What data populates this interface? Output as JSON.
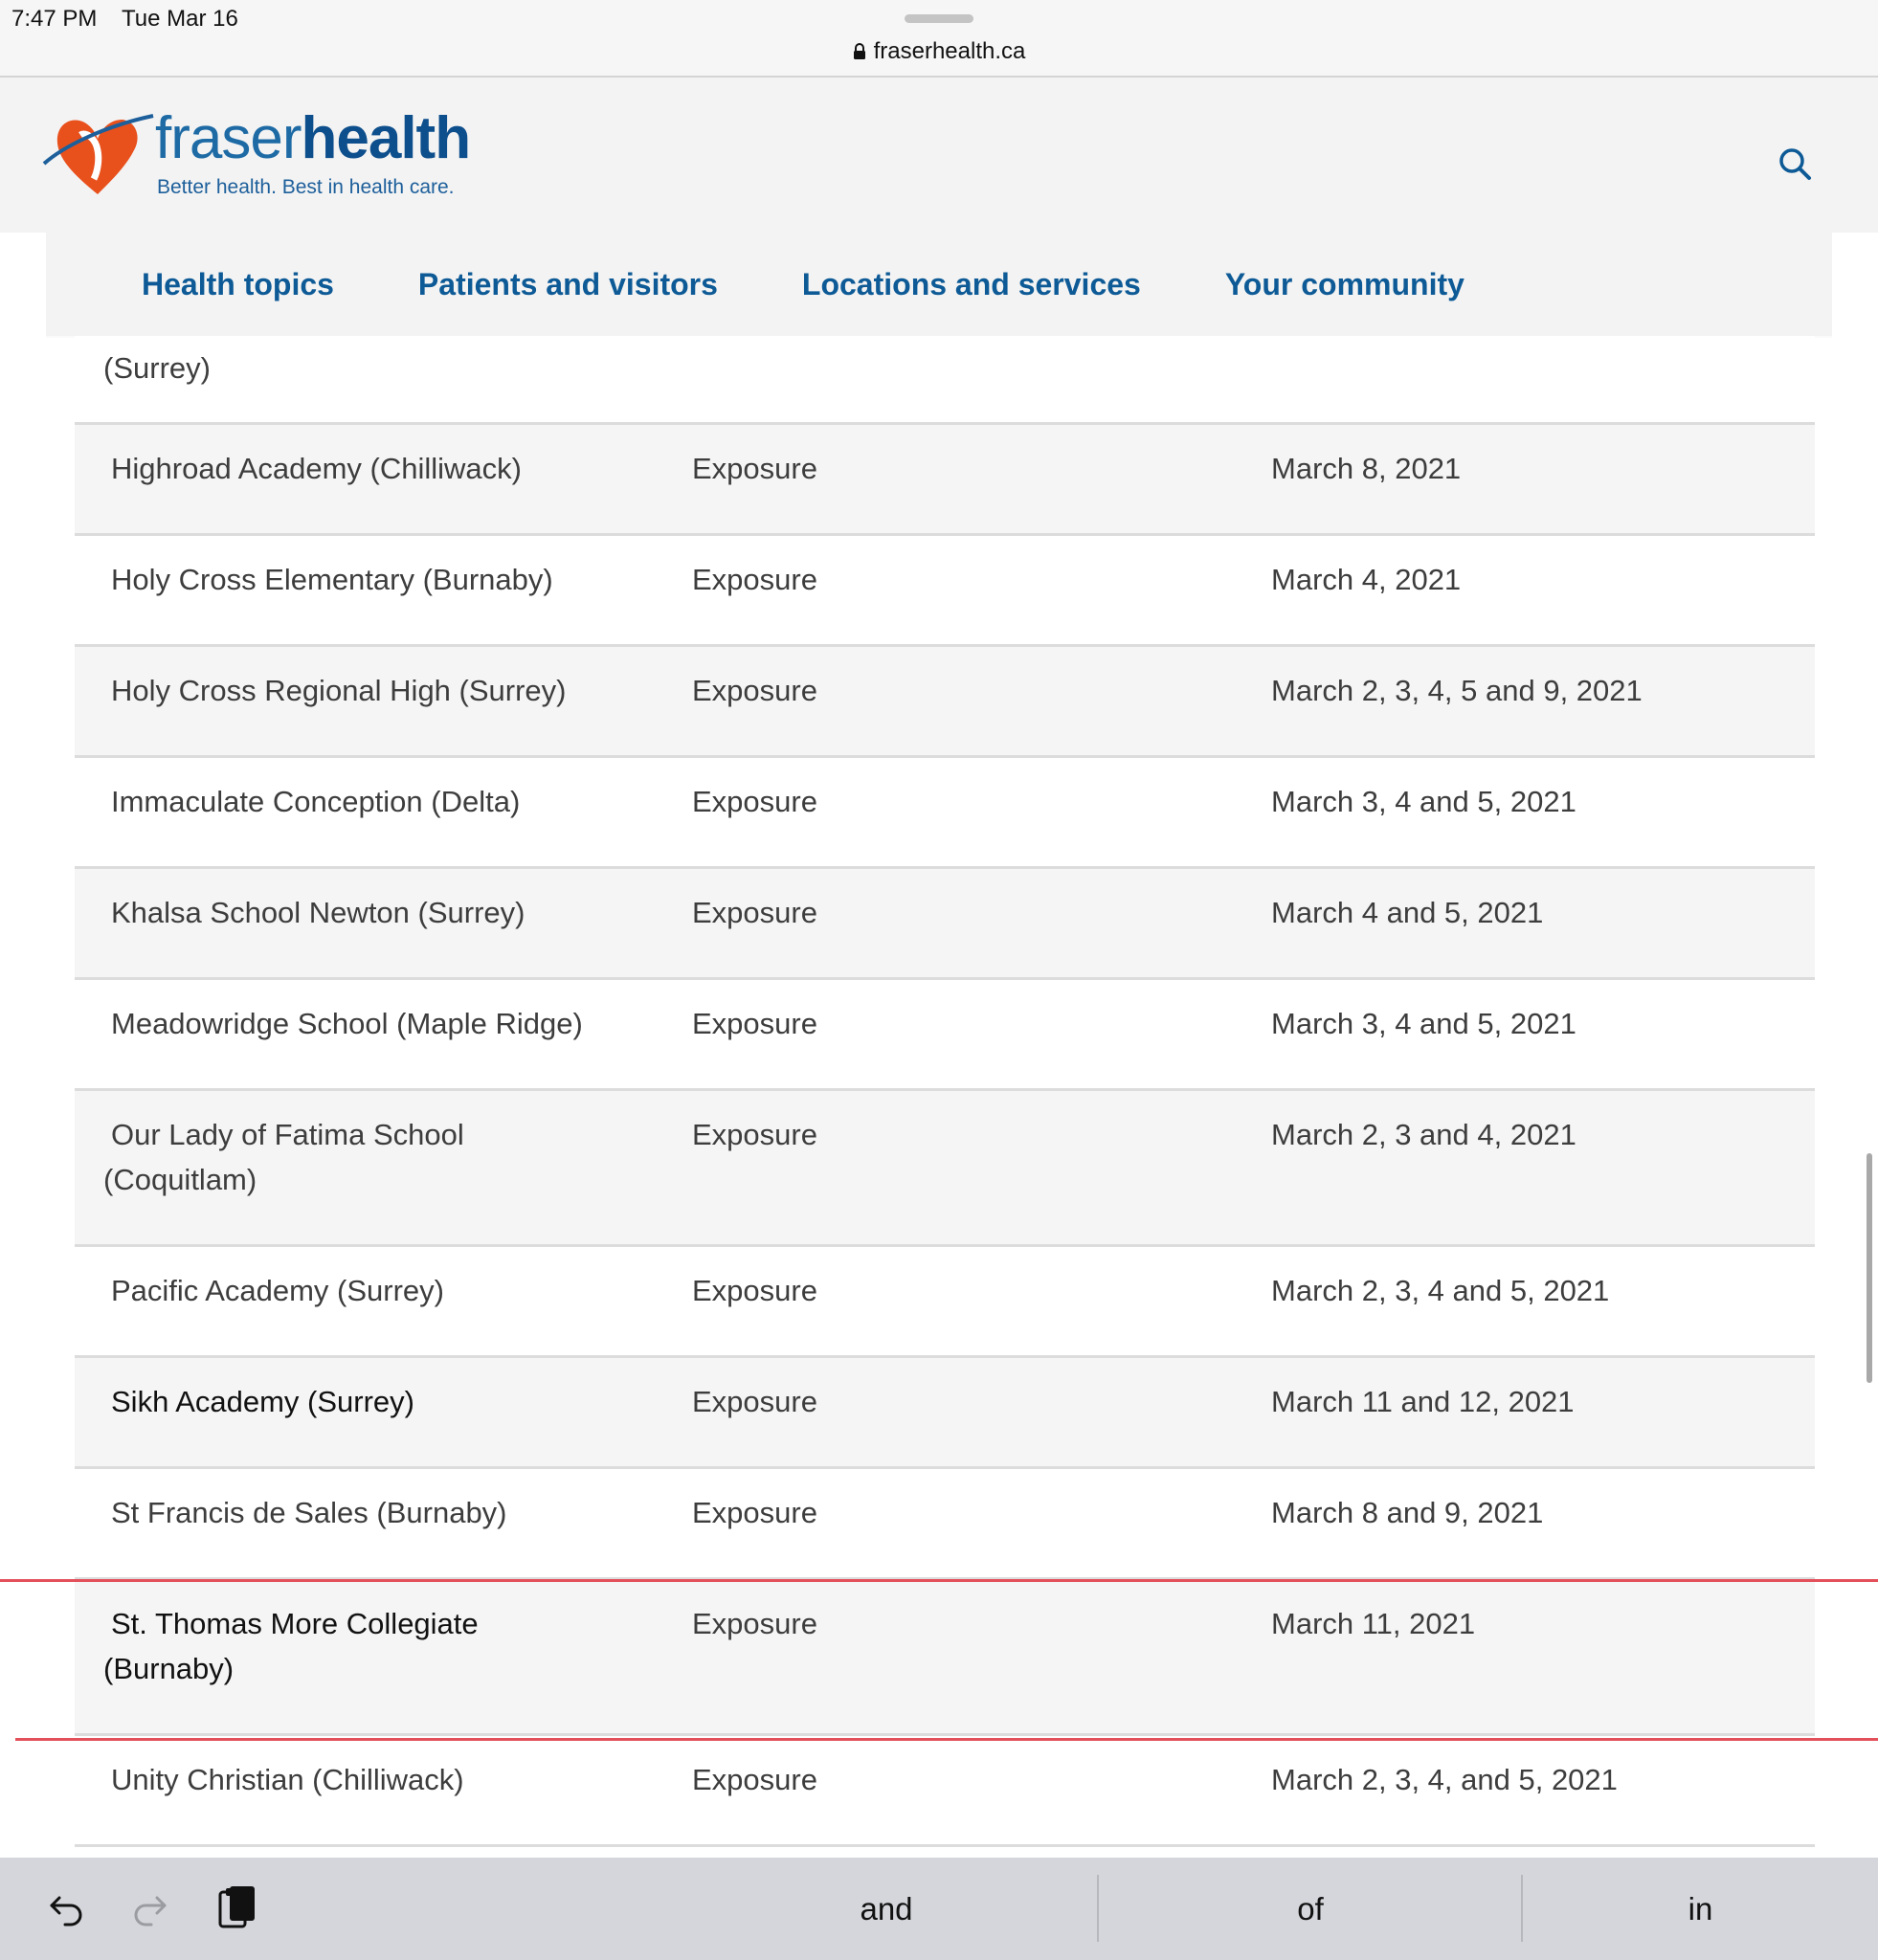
{
  "status_bar": {
    "time": "7:47 PM",
    "date": "Tue Mar 16",
    "url": "fraserhealth.ca"
  },
  "header": {
    "logo_word_light": "fraser",
    "logo_word_bold": "health",
    "tagline": "Better health. Best in health care.",
    "brand_color": "#0d5a96",
    "accent_color": "#e8501c"
  },
  "nav": {
    "items": [
      {
        "label": "Health topics"
      },
      {
        "label": "Patients and visitors"
      },
      {
        "label": "Locations and services"
      },
      {
        "label": "Your community"
      }
    ]
  },
  "table": {
    "partial_row_text": "(Surrey)",
    "rows": [
      {
        "school": "Highroad Academy (Chilliwack)",
        "school2": "",
        "type": "Exposure",
        "dates": "March 8, 2021"
      },
      {
        "school": "Holy Cross Elementary (Burnaby)",
        "school2": "",
        "type": "Exposure",
        "dates": "March 4, 2021"
      },
      {
        "school": "Holy Cross Regional High (Surrey)",
        "school2": "",
        "type": "Exposure",
        "dates": "March 2, 3, 4, 5 and 9, 2021"
      },
      {
        "school": "Immaculate Conception (Delta)",
        "school2": "",
        "type": "Exposure",
        "dates": "March 3, 4 and 5, 2021"
      },
      {
        "school": "Khalsa School Newton (Surrey)",
        "school2": "",
        "type": "Exposure",
        "dates": "March 4 and 5, 2021"
      },
      {
        "school": "Meadowridge School (Maple Ridge)",
        "school2": "",
        "type": "Exposure",
        "dates": "March 3, 4 and 5, 2021"
      },
      {
        "school": "Our Lady of Fatima School",
        "school2": "(Coquitlam)",
        "type": "Exposure",
        "dates": "March 2, 3 and 4, 2021"
      },
      {
        "school": "Pacific Academy (Surrey)",
        "school2": "",
        "type": "Exposure",
        "dates": "March 2, 3, 4 and 5, 2021"
      },
      {
        "school": "Sikh Academy (Surrey)",
        "school2": "",
        "type": "Exposure",
        "dates": "March 11 and 12, 2021"
      },
      {
        "school": "St Francis de Sales (Burnaby)",
        "school2": "",
        "type": "Exposure",
        "dates": "March 8 and 9, 2021"
      },
      {
        "school": "St. Thomas More Collegiate",
        "school2": "(Burnaby)",
        "type": "Exposure",
        "dates": "March 11, 2021"
      },
      {
        "school": "Unity Christian (Chilliwack)",
        "school2": "",
        "type": "Exposure",
        "dates": "March 2, 3, 4, and 5, 2021"
      }
    ]
  },
  "keyboard_bar": {
    "icons": [
      "undo-icon",
      "redo-icon",
      "paste-icon"
    ],
    "suggestions": [
      "and",
      "of",
      "in"
    ]
  }
}
